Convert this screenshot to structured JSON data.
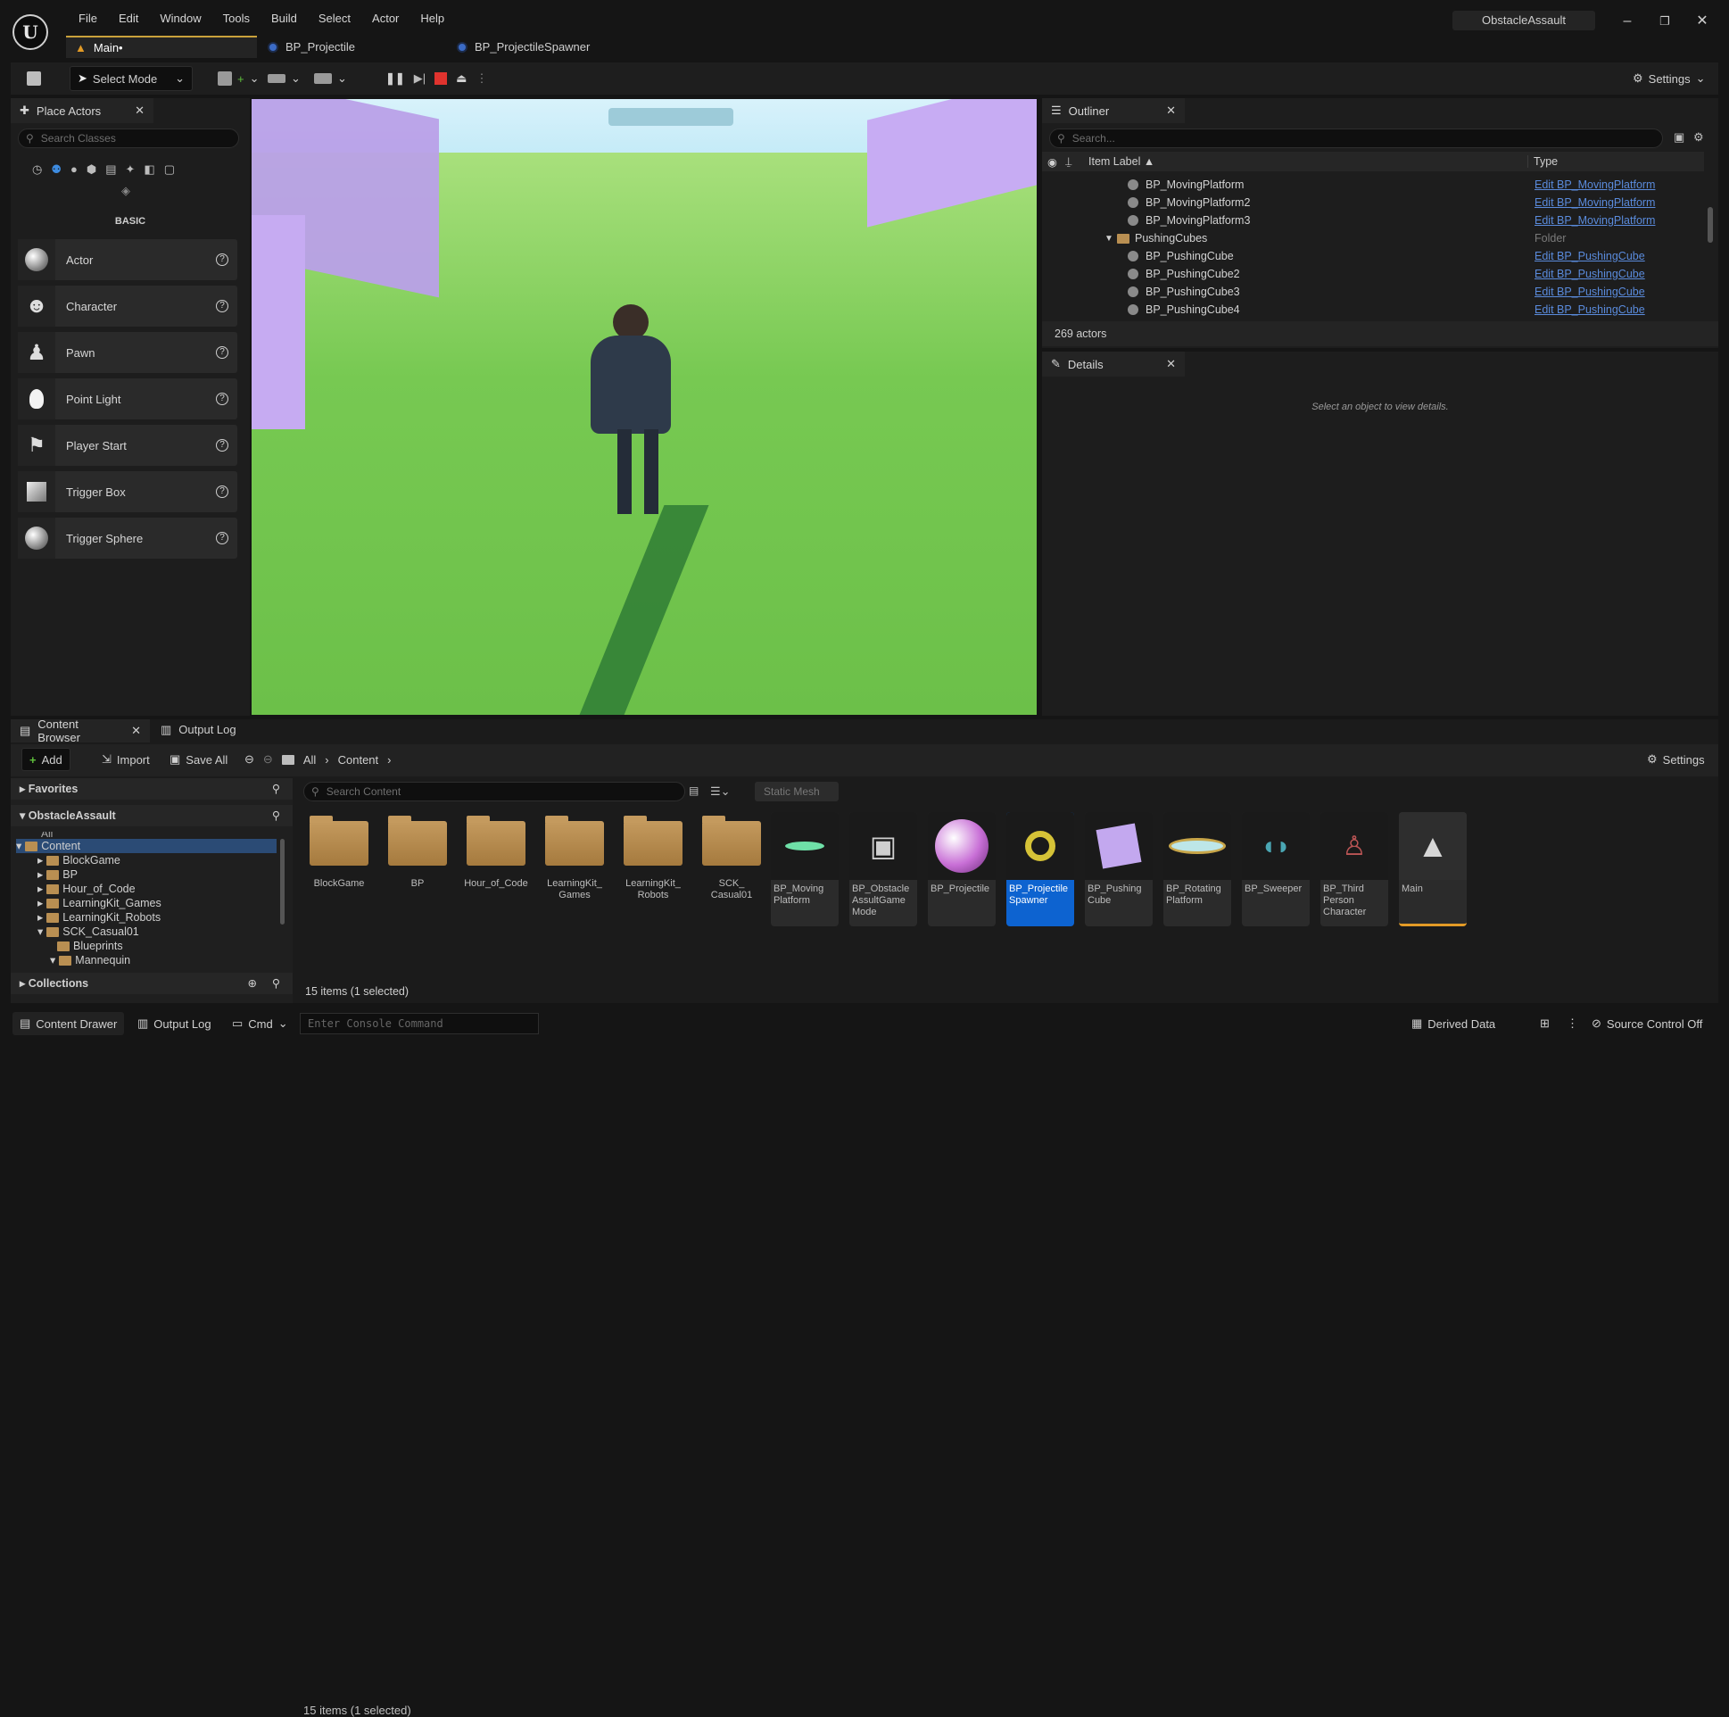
{
  "menu": [
    "File",
    "Edit",
    "Window",
    "Tools",
    "Build",
    "Select",
    "Actor",
    "Help"
  ],
  "project_name": "ObstacleAssault",
  "tabs": [
    {
      "label": "Main•"
    },
    {
      "label": "BP_Projectile"
    },
    {
      "label": "BP_ProjectileSpawner"
    }
  ],
  "toolbar": {
    "mode": "Select Mode",
    "settings": "Settings"
  },
  "place_actors": {
    "title": "Place Actors",
    "search_placeholder": "Search Classes",
    "category": "BASIC",
    "items": [
      {
        "label": "Actor"
      },
      {
        "label": "Character"
      },
      {
        "label": "Pawn"
      },
      {
        "label": "Point Light"
      },
      {
        "label": "Player Start"
      },
      {
        "label": "Trigger Box"
      },
      {
        "label": "Trigger Sphere"
      }
    ]
  },
  "outliner": {
    "title": "Outliner",
    "search_placeholder": "Search...",
    "col_label": "Item Label ▲",
    "col_type": "Type",
    "rows": [
      {
        "label": "BP_MovingPlatform",
        "type": "Edit BP_MovingPlatform"
      },
      {
        "label": "BP_MovingPlatform2",
        "type": "Edit BP_MovingPlatform"
      },
      {
        "label": "BP_MovingPlatform3",
        "type": "Edit BP_MovingPlatform"
      },
      {
        "label": "PushingCubes",
        "type": "Folder"
      },
      {
        "label": "BP_PushingCube",
        "type": "Edit BP_PushingCube"
      },
      {
        "label": "BP_PushingCube2",
        "type": "Edit BP_PushingCube"
      },
      {
        "label": "BP_PushingCube3",
        "type": "Edit BP_PushingCube"
      },
      {
        "label": "BP_PushingCube4",
        "type": "Edit BP_PushingCube"
      }
    ],
    "count": "269 actors"
  },
  "details": {
    "title": "Details",
    "empty": "Select an object to view details."
  },
  "content_browser": {
    "tab": "Content Browser",
    "tab2": "Output Log",
    "add": "Add",
    "import": "Import",
    "save_all": "Save All",
    "path_all": "All",
    "path_content": "Content",
    "settings": "Settings",
    "favorites": "Favorites",
    "project": "ObstacleAssault",
    "tree_all": "All",
    "tree": [
      "Content",
      "BlockGame",
      "BP",
      "Hour_of_Code",
      "LearningKit_Games",
      "LearningKit_Robots",
      "SCK_Casual01",
      "Blueprints",
      "Mannequin"
    ],
    "collections": "Collections",
    "search_placeholder": "Search Content",
    "filter": "Static Mesh",
    "folders": [
      "BlockGame",
      "BP",
      "Hour_of_Code",
      "LearningKit_ Games",
      "LearningKit_ Robots",
      "SCK_ Casual01"
    ],
    "assets": [
      "BP_Moving Platform",
      "BP_Obstacle AssultGame Mode",
      "BP_Projectile",
      "BP_Projectile Spawner",
      "BP_Pushing Cube",
      "BP_Rotating Platform",
      "BP_Sweeper",
      "BP_Third Person Character",
      "Main"
    ],
    "status": "15 items (1 selected)"
  },
  "statusbar": {
    "drawer": "Content Drawer",
    "output": "Output Log",
    "cmd": "Cmd",
    "console_placeholder": "Enter Console Command",
    "derived": "Derived Data",
    "source": "Source Control Off"
  }
}
